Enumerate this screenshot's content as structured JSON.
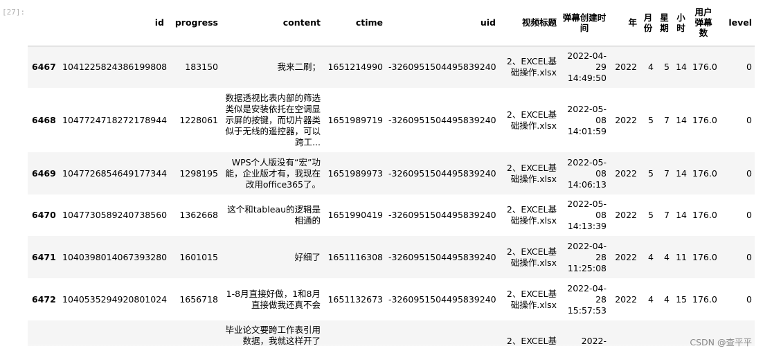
{
  "cell": {
    "prompt": "[27]:"
  },
  "table": {
    "columns": [
      "",
      "id",
      "progress",
      "content",
      "ctime",
      "uid",
      "视频标题",
      "弹幕创建时间",
      "年",
      "月份",
      "星期",
      "小时",
      "用户弹幕数",
      "level"
    ],
    "rows": [
      {
        "index": "6467",
        "id": "1041225824386199808",
        "progress": "183150",
        "content": "我来二刷；",
        "ctime": "1651214990",
        "uid": "-3260951504495839240",
        "title": "2、EXCEL基础操作.xlsx",
        "time": "2022-04-29 14:49:50",
        "year": "2022",
        "month": "4",
        "week": "5",
        "hour": "14",
        "count": "176.0",
        "level": "0"
      },
      {
        "index": "6468",
        "id": "1047724718272178944",
        "progress": "1228061",
        "content": "数据透视比表内部的筛选类似是安装依托在空调显示屏的按键，而切片器类似于无线的遥控器，可以跨工...",
        "ctime": "1651989719",
        "uid": "-3260951504495839240",
        "title": "2、EXCEL基础操作.xlsx",
        "time": "2022-05-08 14:01:59",
        "year": "2022",
        "month": "5",
        "week": "7",
        "hour": "14",
        "count": "176.0",
        "level": "0"
      },
      {
        "index": "6469",
        "id": "1047726854649177344",
        "progress": "1298195",
        "content": "WPS个人版没有“宏”功能，企业版才有，我现在改用office365了。",
        "ctime": "1651989973",
        "uid": "-3260951504495839240",
        "title": "2、EXCEL基础操作.xlsx",
        "time": "2022-05-08 14:06:13",
        "year": "2022",
        "month": "5",
        "week": "7",
        "hour": "14",
        "count": "176.0",
        "level": "0"
      },
      {
        "index": "6470",
        "id": "1047730589240738560",
        "progress": "1362668",
        "content": "这个和tableau的逻辑是相通的",
        "ctime": "1651990419",
        "uid": "-3260951504495839240",
        "title": "2、EXCEL基础操作.xlsx",
        "time": "2022-05-08 14:13:39",
        "year": "2022",
        "month": "5",
        "week": "7",
        "hour": "14",
        "count": "176.0",
        "level": "0"
      },
      {
        "index": "6471",
        "id": "1040398014067393280",
        "progress": "1601015",
        "content": "好细了",
        "ctime": "1651116308",
        "uid": "-3260951504495839240",
        "title": "2、EXCEL基础操作.xlsx",
        "time": "2022-04-28 11:25:08",
        "year": "2022",
        "month": "4",
        "week": "4",
        "hour": "11",
        "count": "176.0",
        "level": "0"
      },
      {
        "index": "6472",
        "id": "1040535294920801024",
        "progress": "1656718",
        "content": "1-8月直接好做，1和8月直接做我还真不会",
        "ctime": "1651132673",
        "uid": "-3260951504495839240",
        "title": "2、EXCEL基础操作.xlsx",
        "time": "2022-04-28 15:57:53",
        "year": "2022",
        "month": "4",
        "week": "4",
        "hour": "15",
        "count": "176.0",
        "level": "0"
      },
      {
        "index": "",
        "id": "",
        "progress": "",
        "content": "毕业论文要跨工作表引用数据，我就这样开了",
        "ctime": "",
        "uid": "",
        "title": "2、EXCEL基",
        "time": "2022-",
        "year": "",
        "month": "",
        "week": "",
        "hour": "",
        "count": "",
        "level": ""
      }
    ]
  },
  "watermark": "CSDN @查平平"
}
